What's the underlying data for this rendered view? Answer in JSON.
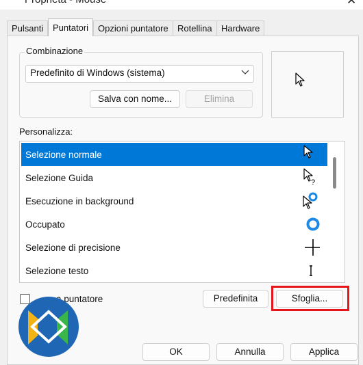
{
  "window": {
    "title": "Proprietà - Mouse",
    "close_glyph": "✕"
  },
  "tabs": [
    {
      "label": "Pulsanti"
    },
    {
      "label": "Puntatori"
    },
    {
      "label": "Opzioni puntatore"
    },
    {
      "label": "Rotellina"
    },
    {
      "label": "Hardware"
    }
  ],
  "scheme": {
    "group_label": "Combinazione",
    "selected": "Predefinito di Windows (sistema)",
    "save_label": "Salva con nome...",
    "delete_label": "Elimina"
  },
  "customize": {
    "label": "Personalizza:",
    "items": [
      {
        "label": "Selezione normale",
        "icon": "arrow-cursor-icon",
        "selected": true
      },
      {
        "label": "Selezione Guida",
        "icon": "help-select-cursor-icon"
      },
      {
        "label": "Esecuzione in background",
        "icon": "working-in-background-cursor-icon"
      },
      {
        "label": "Occupato",
        "icon": "busy-cursor-icon"
      },
      {
        "label": "Selezione di precisione",
        "icon": "precision-select-cursor-icon"
      },
      {
        "label": "Selezione testo",
        "icon": "text-select-cursor-icon"
      }
    ]
  },
  "shadow_option": {
    "label": "a puntatore",
    "checked": false
  },
  "buttons": {
    "default_label": "Predefinita",
    "browse_label": "Sfoglia...",
    "ok": "OK",
    "cancel": "Annulla",
    "apply": "Applica"
  },
  "colors": {
    "selection": "#0078d7",
    "highlight_box": "#e8141c",
    "busy_ring": "#1e88e5"
  }
}
